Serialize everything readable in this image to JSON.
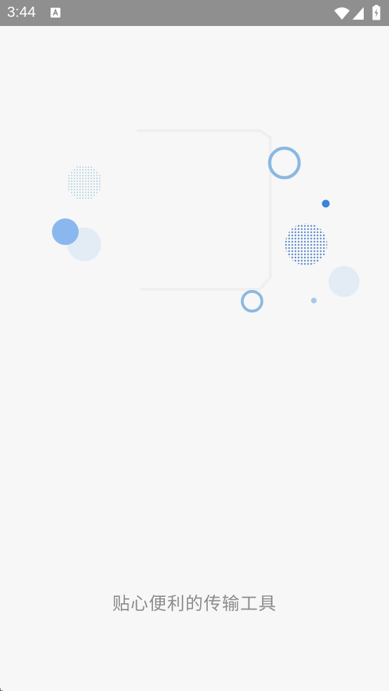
{
  "status_bar": {
    "time": "3:44",
    "notification_icon": "text-a-icon",
    "wifi_icon": "wifi-icon",
    "signal_icon": "cell-signal-icon",
    "battery_icon": "battery-charging-icon",
    "background_color": "#8f8f8f"
  },
  "splash": {
    "tagline": "贴心便利的传输工具",
    "illustration_icon": "decorative-bubbles-illustration",
    "accent_color": "#8ab8ee",
    "background_color": "#f7f7f7"
  }
}
